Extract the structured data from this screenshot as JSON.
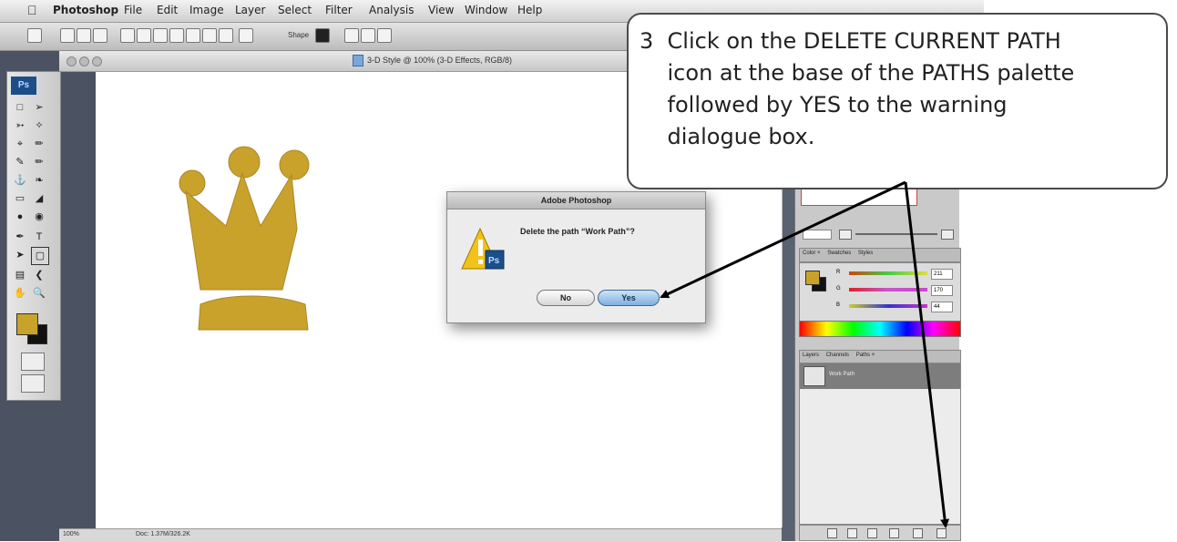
{
  "menubar": {
    "app_name": "Photoshop",
    "items": [
      "File",
      "Edit",
      "Image",
      "Layer",
      "Select",
      "Filter",
      "Analysis",
      "View",
      "Window",
      "Help"
    ]
  },
  "options_bar": {
    "shape_label": "Shape"
  },
  "document": {
    "title": "3-D Style @ 100% (3-D Effects, RGB/8)",
    "status_zoom": "100%",
    "status_doc": "Doc: 1.37M/326.2K"
  },
  "tools": {
    "ps_logo": "Ps"
  },
  "crown_color": "#c9a22c",
  "dialog": {
    "title": "Adobe Photoshop",
    "message": "Delete the path “Work Path”?",
    "no_label": "No",
    "yes_label": "Yes",
    "app_badge": "Ps"
  },
  "palettes": {
    "color_tabs": [
      "Color ×",
      "Swatches",
      "Styles"
    ],
    "color_sliders": [
      {
        "label": "R",
        "value": "211",
        "gradient": "linear-gradient(90deg,#c41,#4c4,#dd4)"
      },
      {
        "label": "G",
        "value": "170",
        "gradient": "linear-gradient(90deg,#d22,#c5c,#c4c)"
      },
      {
        "label": "B",
        "value": "44",
        "gradient": "linear-gradient(90deg,#cc3,#33c,#c3c)"
      }
    ],
    "layer_tabs": [
      "Layers",
      "Channels",
      "Paths ×"
    ],
    "path_name": "Work Path"
  },
  "callout": {
    "text": "3  Click on the DELETE CURRENT PATH\n    icon at the base of the PATHS palette\n    followed by YES to the warning\n    dialogue box."
  }
}
